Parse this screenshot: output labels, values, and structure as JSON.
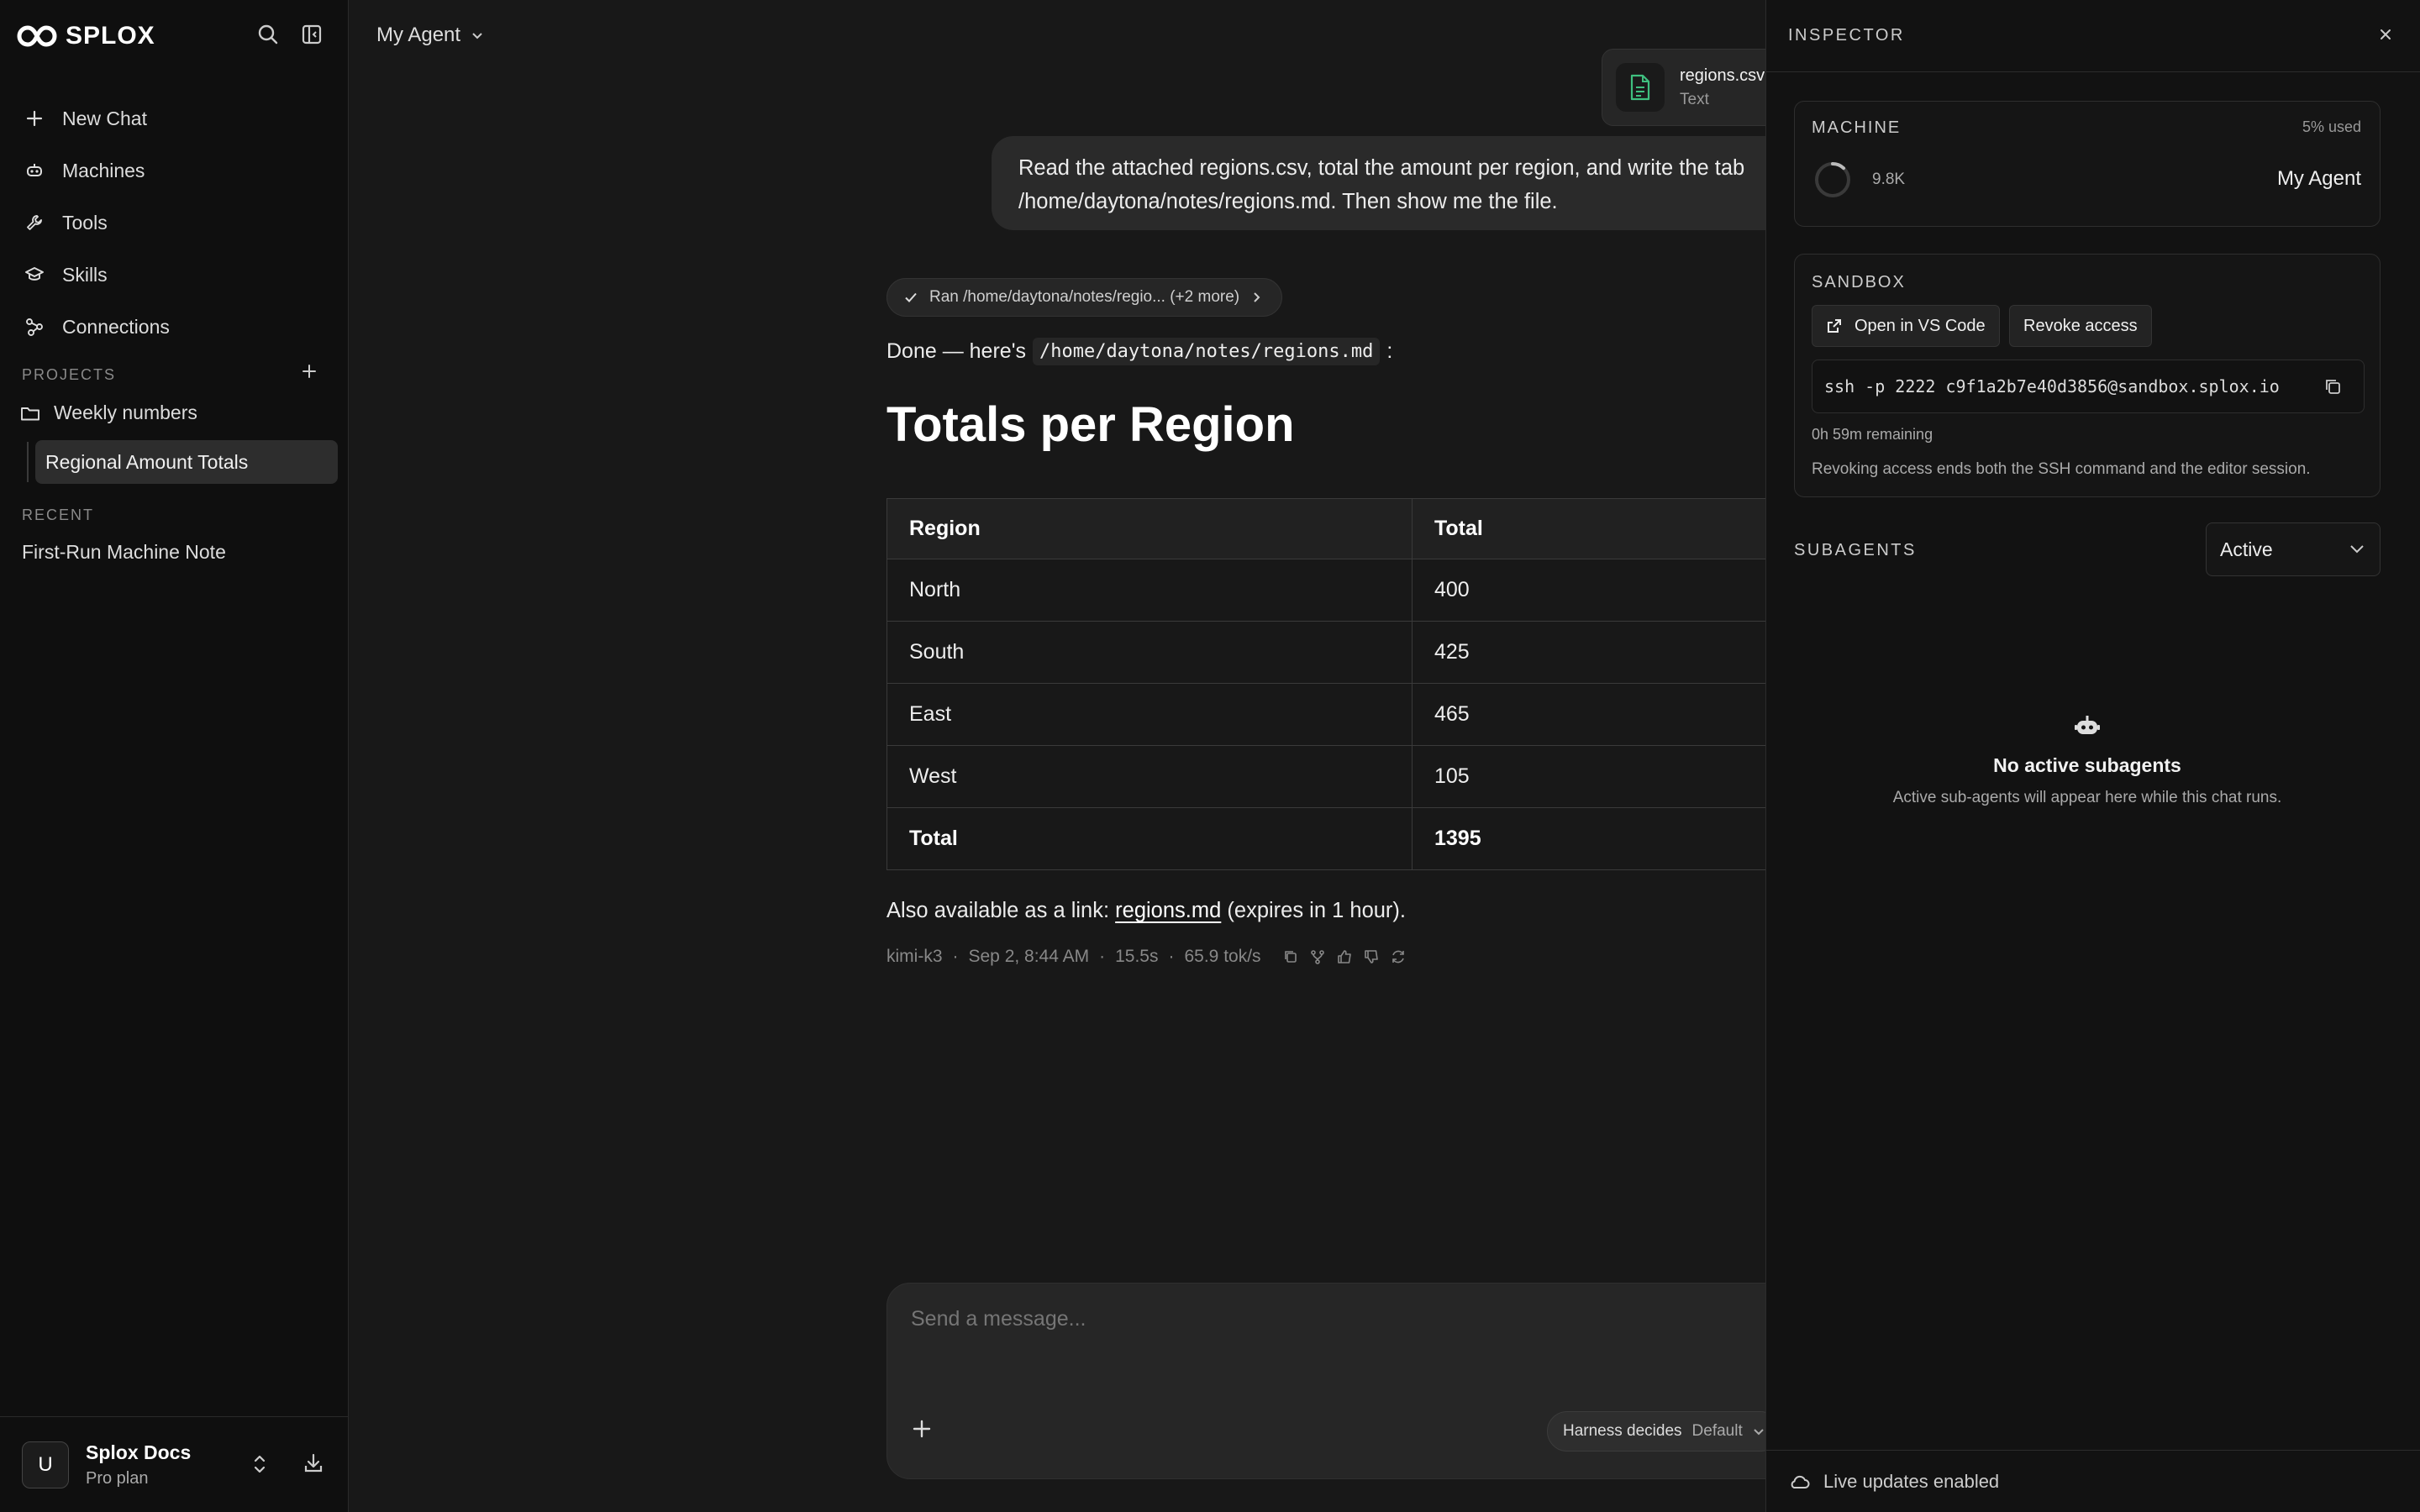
{
  "brand": {
    "name": "SPLOX"
  },
  "sidebar": {
    "nav": [
      {
        "label": "New Chat",
        "icon": "plus-icon"
      },
      {
        "label": "Machines",
        "icon": "robot-icon"
      },
      {
        "label": "Tools",
        "icon": "wrench-icon"
      },
      {
        "label": "Skills",
        "icon": "graduation-cap-icon"
      },
      {
        "label": "Connections",
        "icon": "connections-icon"
      }
    ],
    "projects_label": "PROJECTS",
    "project": {
      "name": "Weekly numbers",
      "child": "Regional Amount Totals"
    },
    "recent_label": "RECENT",
    "recent": [
      "First-Run Machine Note"
    ],
    "account": {
      "initial": "U",
      "name": "Splox Docs",
      "plan": "Pro plan"
    }
  },
  "header": {
    "agent": "My Agent"
  },
  "attachment": {
    "name": "regions.csv",
    "type": "Text"
  },
  "user_message": {
    "line1": "Read the attached regions.csv, total the amount per region, and write the tab",
    "line2": "/home/daytona/notes/regions.md. Then show me the file."
  },
  "assistant": {
    "ran_pill": "Ran /home/daytona/notes/regio... (+2 more)",
    "done_prefix": "Done — here's",
    "done_path": "/home/daytona/notes/regions.md",
    "done_suffix": ":",
    "title": "Totals per Region",
    "table": {
      "headers": [
        "Region",
        "Total"
      ],
      "rows": [
        [
          "North",
          "400"
        ],
        [
          "South",
          "425"
        ],
        [
          "East",
          "465"
        ],
        [
          "West",
          "105"
        ]
      ],
      "total": [
        "Total",
        "1395"
      ]
    },
    "also_prefix": "Also available as a link:",
    "also_link": "regions.md",
    "also_suffix": "(expires in 1 hour).",
    "meta": {
      "model": "kimi-k3",
      "date": "Sep 2, 8:44 AM",
      "duration": "15.5s",
      "speed": "65.9 tok/s",
      "sep": "·"
    }
  },
  "composer": {
    "placeholder": "Send a message...",
    "harness_label": "Harness decides",
    "harness_value": "Default"
  },
  "inspector": {
    "title": "INSPECTOR",
    "machine": {
      "label": "MACHINE",
      "used": "5% used",
      "usage_fraction": 0.05,
      "count": "9.8K",
      "name": "My Agent"
    },
    "sandbox": {
      "label": "SANDBOX",
      "open_vscode": "Open in VS Code",
      "revoke": "Revoke access",
      "ssh": "ssh -p 2222 c9f1a2b7e40d3856@sandbox.splox.io",
      "remaining": "0h 59m remaining",
      "note": "Revoking access ends both the SSH command and the editor session."
    },
    "subagents": {
      "label": "SUBAGENTS",
      "filter": "Active",
      "empty_title": "No active subagents",
      "empty_sub": "Active sub-agents will appear here while this chat runs."
    },
    "footer": "Live updates enabled"
  }
}
